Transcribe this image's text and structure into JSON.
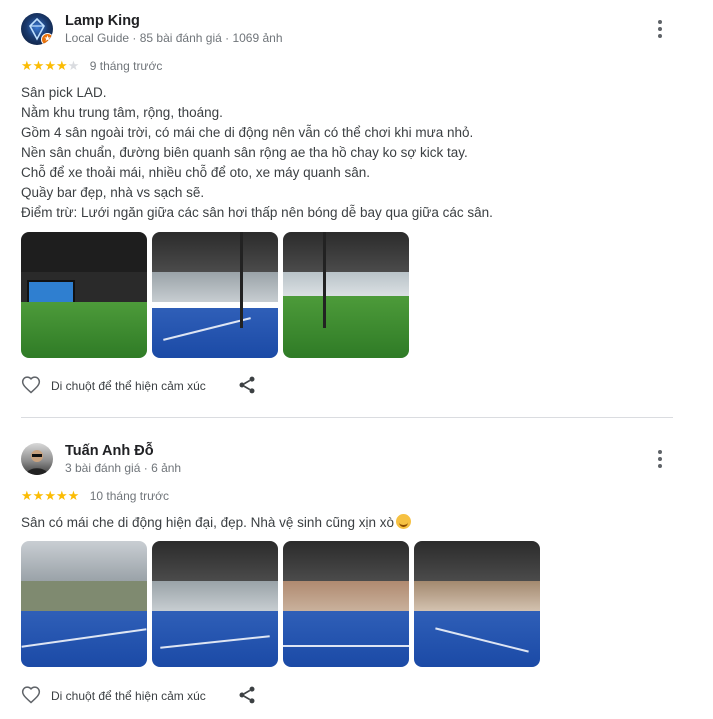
{
  "reviews": [
    {
      "author": "Lamp King",
      "meta": "Local Guide · 85 bài đánh giá · 1069 ảnh",
      "stars": 4,
      "time": "9 tháng trước",
      "lines": [
        "Sân pick LAD.",
        "Nằm khu trung tâm, rộng, thoáng.",
        "Gồm 4 sân ngoài trời, có mái che di động nên vẫn có thể chơi khi mưa nhỏ.",
        "Nền sân chuẩn, đường biên quanh sân rộng ae tha hồ chay ko sợ kick tay.",
        "Chỗ để xe thoải mái, nhiều chỗ để oto, xe máy quanh sân.",
        "Quầy bar đẹp, nhà vs sạch sẽ.",
        "Điểm trừ: Lưới ngăn giữa các sân hơi thấp nên bóng dễ bay qua giữa các sân."
      ],
      "photo_count": 3,
      "react_label": "Di chuột để thể hiện cảm xúc"
    },
    {
      "author": "Tuấn Anh Đỗ",
      "meta": "3 bài đánh giá · 6 ảnh",
      "stars": 5,
      "time": "10 tháng trước",
      "text": "Sân có mái che di động hiện đại, đẹp. Nhà vệ sinh cũng xịn xò",
      "photo_count": 4,
      "react_label": "Di chuột để thể hiện cảm xúc"
    }
  ],
  "icons": {
    "more": "more-vert-icon",
    "heart": "heart-outline-icon",
    "share": "share-icon",
    "badge": "local-guide-badge-icon"
  },
  "colors": {
    "star": "#fbbc04",
    "star_empty": "#dadce0",
    "secondary_text": "#70757a",
    "divider": "#dadce0"
  }
}
